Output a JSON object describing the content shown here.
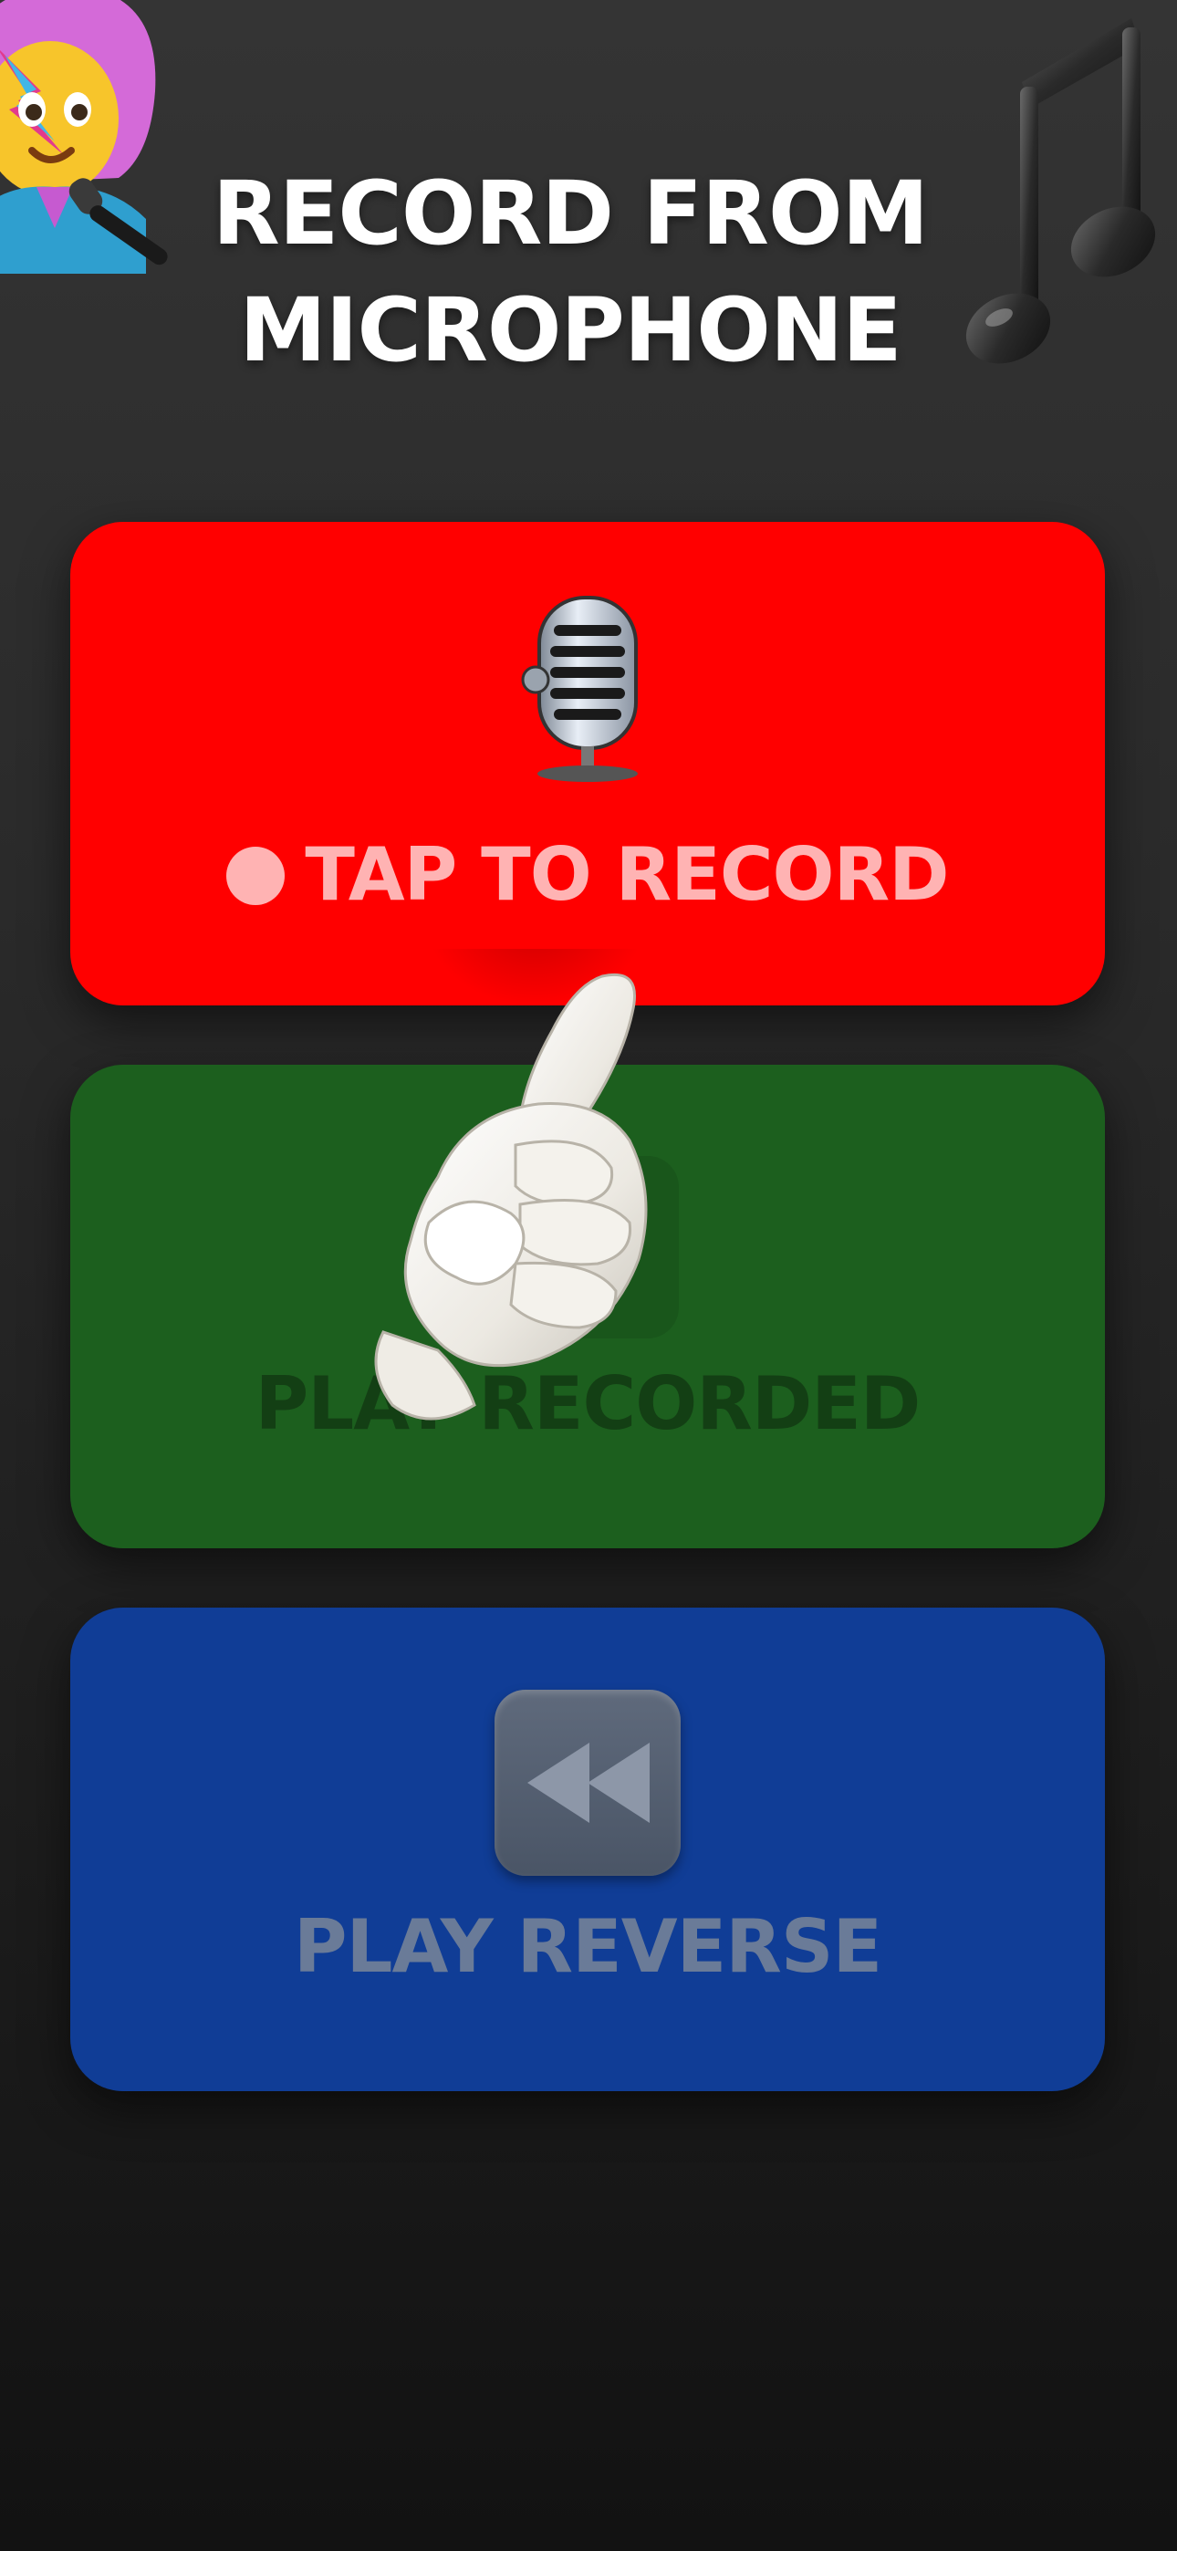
{
  "header": {
    "title_line1": "RECORD FROM",
    "title_line2": "MICROPHONE",
    "left_decoration_icon": "singer-emoji-icon",
    "right_decoration_icon": "musical-notes-icon"
  },
  "record_button": {
    "label": "TAP TO RECORD",
    "icon": "studio-microphone-icon",
    "indicator_icon": "record-dot-icon",
    "color": "#ff0000"
  },
  "play_button": {
    "label": "PLAY RECORDED",
    "icon": "play-icon",
    "color": "#1c5f1e",
    "state": "disabled"
  },
  "reverse_button": {
    "label": "PLAY REVERSE",
    "icon": "rewind-icon",
    "color": "#103d96",
    "state": "disabled"
  },
  "overlay": {
    "icon": "pointing-hand-icon"
  }
}
